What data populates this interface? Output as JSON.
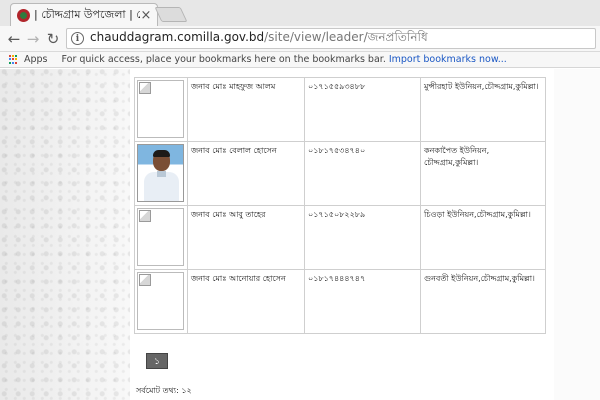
{
  "browser": {
    "tab_title": "| চৌদ্দগ্রাম উপজেলা | চৌদ্দগ্",
    "tab_close": "×",
    "url_host": "chauddagram.comilla.gov.bd",
    "url_path": "/site/view/leader/জনপ্রতিনিধি",
    "bookmarks": {
      "apps_label": "Apps",
      "hint": "For quick access, place your bookmarks here on the bookmarks bar.",
      "import_link": "Import bookmarks now..."
    }
  },
  "leaders": [
    {
      "name": "জনাব মোঃ মাহফুজ আলম",
      "phone": "০১৭১৫৫৯৩৪৮৮",
      "union": "মুন্সীরহাট ইউনিয়ন,চৌদ্দগ্রাম,কুমিল্লা।",
      "photo": "broken"
    },
    {
      "name": "জনাব মোঃ বেলাল হোসেন",
      "phone": "০১৮১৭৫৩৪৭৪০",
      "union": "কনকাপৈত ইউনিয়ন, চৌদ্দগ্রাম,কুমিল্লা।",
      "photo": "portrait"
    },
    {
      "name": "জনাব মোঃ আবু তাহের",
      "phone": "০১৭১৫০৮২২৮৯",
      "union": "চিওড়া ইউনিয়ন,চৌদ্দগ্রাম,কুমিল্লা।",
      "photo": "broken"
    },
    {
      "name": "জনাব মোঃ আনোয়ার হোসেন",
      "phone": "০১৮১৭৪৪৪৭৪৭",
      "union": "গুনবতী ইউনিয়ন,চৌদ্দগ্রাম,কুমিল্লা।",
      "photo": "broken"
    }
  ],
  "pagination": {
    "current_page": "১"
  },
  "footer": {
    "total_label": "সর্বমোট তথ্য: ১২"
  }
}
